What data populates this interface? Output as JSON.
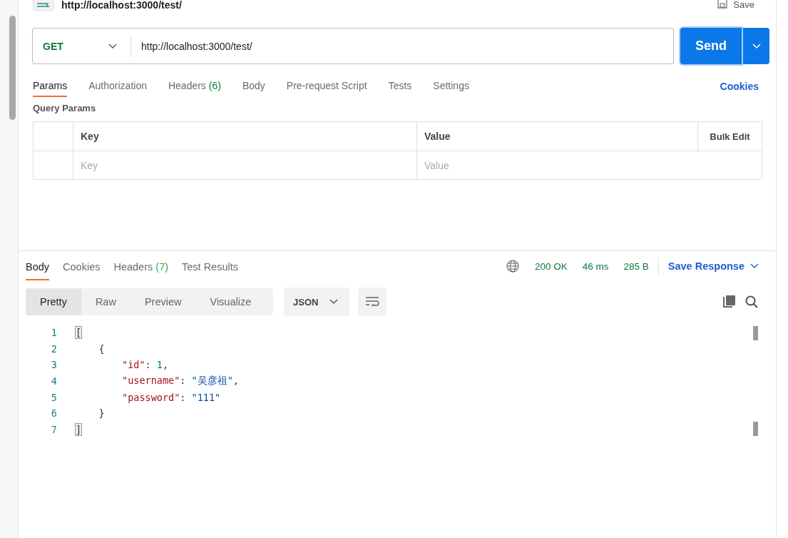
{
  "header": {
    "title": "http://localhost:3000/test/",
    "save_label": "Save"
  },
  "request": {
    "method": "GET",
    "url": "http://localhost:3000/test/",
    "send_label": "Send"
  },
  "request_tabs": [
    {
      "label": "Params",
      "selected": true
    },
    {
      "label": "Authorization",
      "selected": false
    },
    {
      "label": "Headers",
      "count": "(6)",
      "selected": false
    },
    {
      "label": "Body",
      "selected": false
    },
    {
      "label": "Pre-request Script",
      "selected": false
    },
    {
      "label": "Tests",
      "selected": false
    },
    {
      "label": "Settings",
      "selected": false
    }
  ],
  "cookies_link": "Cookies",
  "query_params": {
    "title": "Query Params",
    "columns": [
      "Key",
      "Value"
    ],
    "bulk_edit": "Bulk Edit",
    "key_placeholder": "Key",
    "value_placeholder": "Value"
  },
  "response_tabs": [
    {
      "label": "Body",
      "selected": true
    },
    {
      "label": "Cookies",
      "selected": false
    },
    {
      "label": "Headers",
      "count": "(7)",
      "selected": false
    },
    {
      "label": "Test Results",
      "selected": false
    }
  ],
  "status": {
    "code": "200 OK",
    "time": "46 ms",
    "size": "285 B",
    "save_response": "Save Response"
  },
  "view_modes": [
    {
      "label": "Pretty",
      "selected": true
    },
    {
      "label": "Raw",
      "selected": false
    },
    {
      "label": "Preview",
      "selected": false
    },
    {
      "label": "Visualize",
      "selected": false
    }
  ],
  "format": "JSON",
  "code": [
    {
      "number": "1",
      "tokens": [
        {
          "kind": "match",
          "text": "["
        }
      ]
    },
    {
      "number": "2",
      "tokens": [
        {
          "kind": "punct",
          "text": "    {"
        }
      ]
    },
    {
      "number": "3",
      "tokens": [
        {
          "kind": "key",
          "text": "        \"id\""
        },
        {
          "kind": "punct",
          "text": ": "
        },
        {
          "kind": "number",
          "text": "1"
        },
        {
          "kind": "punct",
          "text": ","
        }
      ]
    },
    {
      "number": "4",
      "tokens": [
        {
          "kind": "key",
          "text": "        \"username\""
        },
        {
          "kind": "punct",
          "text": ": "
        },
        {
          "kind": "string",
          "text": "\"吴彦祖\""
        },
        {
          "kind": "punct",
          "text": ","
        }
      ]
    },
    {
      "number": "5",
      "tokens": [
        {
          "kind": "key",
          "text": "        \"password\""
        },
        {
          "kind": "punct",
          "text": ": "
        },
        {
          "kind": "string",
          "text": "\"111\""
        }
      ]
    },
    {
      "number": "6",
      "tokens": [
        {
          "kind": "punct",
          "text": "    }"
        }
      ]
    },
    {
      "number": "7",
      "tokens": [
        {
          "kind": "match",
          "text": "]"
        }
      ]
    }
  ]
}
